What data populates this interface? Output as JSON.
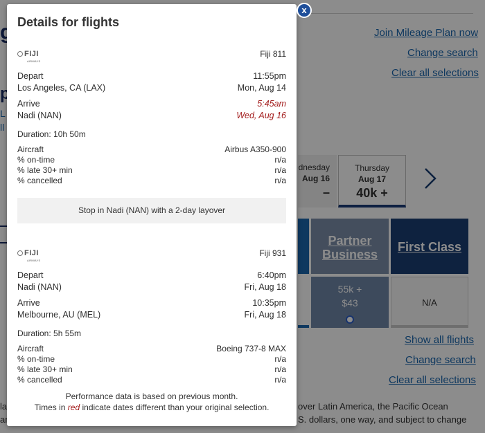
{
  "background": {
    "links": {
      "join_mileage": "Join Mileage Plan now",
      "change_search_top": "Change search",
      "clear_top": "Clear all selections",
      "show_all": "Show all flights",
      "change_search_bottom": "Change search",
      "clear_bottom": "Clear all selections"
    },
    "fragments": {
      "title": "gl",
      "title2": "p",
      "frag1": "L",
      "frag2": "ll"
    },
    "dates": [
      {
        "day": "dnesday",
        "date": "Aug 16",
        "price": "–"
      },
      {
        "day": "Thursday",
        "date": "Aug 17",
        "price": "40k +"
      }
    ],
    "cabins": {
      "partner": "Partner Business",
      "partner_l1": "Partner",
      "partner_l2": "Business",
      "first": "First Class"
    },
    "fares": {
      "partner_l1": "55k +",
      "partner_l2": "$43",
      "first": "N/A"
    },
    "footer": {
      "line1_frag": "over Latin America, the Pacific Ocean",
      "line2_frag": "S. dollars, one way, and subject to change",
      "left1": "la",
      "left2": "ar"
    }
  },
  "modal": {
    "title": "Details for flights",
    "close": "x",
    "segments": [
      {
        "airline_logo": "FIJI",
        "airline_sub": "AIRWAYS",
        "flight": "Fiji 811",
        "depart_label": "Depart",
        "depart_time": "11:55pm",
        "depart_city": "Los Angeles, CA (LAX)",
        "depart_date": "Mon, Aug 14",
        "arrive_label": "Arrive",
        "arrive_time": "5:45am",
        "arrive_city": "Nadi (NAN)",
        "arrive_date": "Wed, Aug 16",
        "duration": "Duration: 10h 50m",
        "aircraft_label": "Aircraft",
        "aircraft": "Airbus A350-900",
        "ontime_label": "% on-time",
        "ontime": "n/a",
        "late_label": "% late 30+ min",
        "late": "n/a",
        "cancelled_label": "% cancelled",
        "cancelled": "n/a"
      },
      {
        "airline_logo": "FIJI",
        "airline_sub": "AIRWAYS",
        "flight": "Fiji 931",
        "depart_label": "Depart",
        "depart_time": "6:40pm",
        "depart_city": "Nadi (NAN)",
        "depart_date": "Fri, Aug 18",
        "arrive_label": "Arrive",
        "arrive_time": "10:35pm",
        "arrive_city": "Melbourne, AU (MEL)",
        "arrive_date": "Fri, Aug 18",
        "duration": "Duration: 5h 55m",
        "aircraft_label": "Aircraft",
        "aircraft": "Boeing 737-8 MAX",
        "ontime_label": "% on-time",
        "ontime": "n/a",
        "late_label": "% late 30+ min",
        "late": "n/a",
        "cancelled_label": "% cancelled",
        "cancelled": "n/a"
      }
    ],
    "layover": "Stop in Nadi (NAN) with a 2-day layover",
    "note_line1": "Performance data is based on previous month.",
    "note_line2_pre": "Times in ",
    "note_line2_red": "red",
    "note_line2_post": " indicate dates different than your original selection."
  },
  "colors": {
    "brand": "#1b66ad",
    "navy": "#1a3e73",
    "alert_red": "#a31c1c"
  }
}
